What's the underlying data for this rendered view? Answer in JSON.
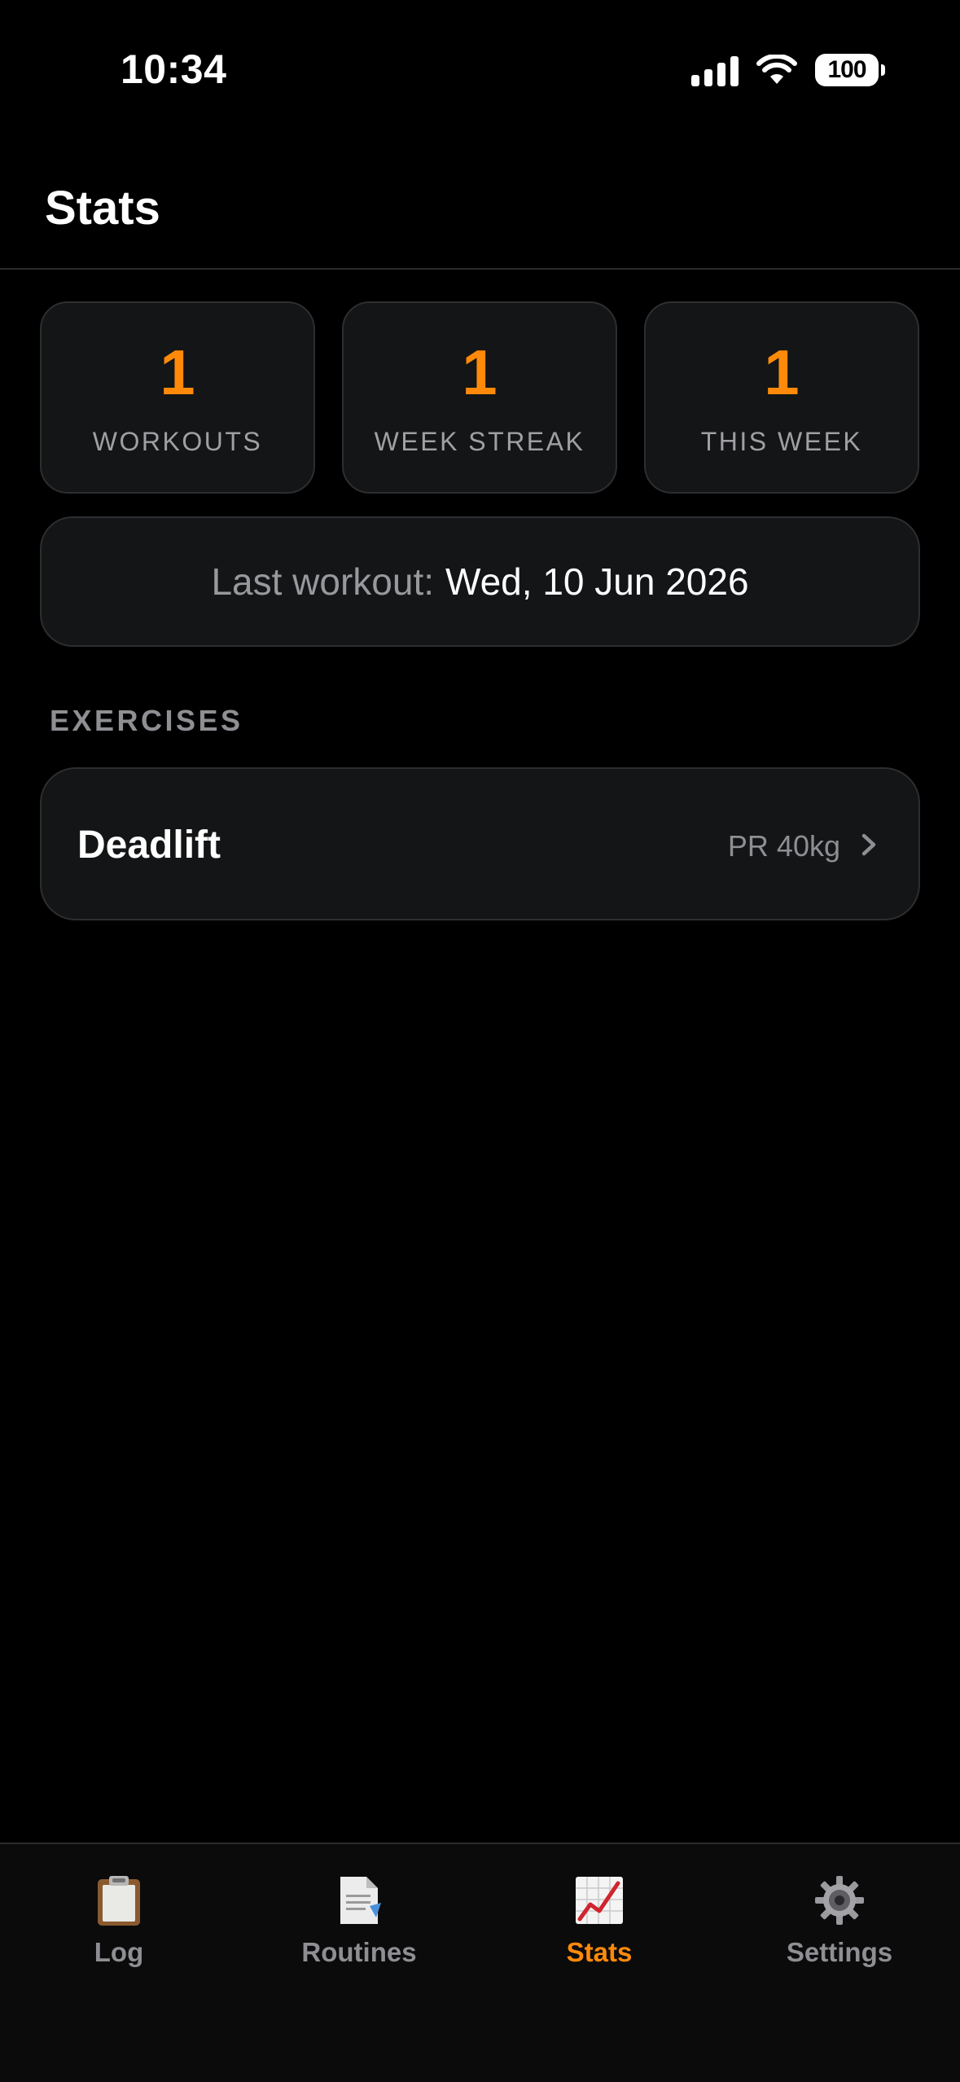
{
  "status_bar": {
    "time": "10:34",
    "battery": "100",
    "icons": [
      "cellular-signal-icon",
      "wifi-icon",
      "battery-icon"
    ]
  },
  "header": {
    "title": "Stats"
  },
  "stats": [
    {
      "value": "1",
      "label": "WORKOUTS"
    },
    {
      "value": "1",
      "label": "WEEK STREAK"
    },
    {
      "value": "1",
      "label": "THIS WEEK"
    }
  ],
  "last_workout": {
    "label": "Last workout:",
    "date": "Wed, 10 Jun 2026"
  },
  "exercises": {
    "header": "EXERCISES",
    "items": [
      {
        "name": "Deadlift",
        "pr": "PR 40kg"
      }
    ]
  },
  "tab_bar": {
    "tabs": [
      {
        "label": "Log",
        "icon": "clipboard-icon",
        "active": false
      },
      {
        "label": "Routines",
        "icon": "document-icon",
        "active": false
      },
      {
        "label": "Stats",
        "icon": "chart-increasing-icon",
        "active": true
      },
      {
        "label": "Settings",
        "icon": "gear-icon",
        "active": false
      }
    ]
  },
  "colors": {
    "accent": "#ff8a0a",
    "background": "#000000",
    "card": "#141516",
    "card_border": "#2d2e30",
    "muted_text": "#8e8e93"
  }
}
